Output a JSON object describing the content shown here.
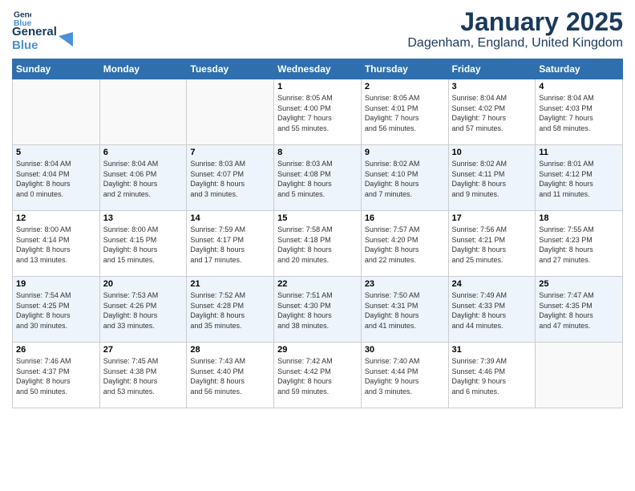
{
  "logo": {
    "line1": "General",
    "line2": "Blue"
  },
  "title": "January 2025",
  "location": "Dagenham, England, United Kingdom",
  "days_of_week": [
    "Sunday",
    "Monday",
    "Tuesday",
    "Wednesday",
    "Thursday",
    "Friday",
    "Saturday"
  ],
  "weeks": [
    {
      "days": [
        {
          "num": "",
          "info": ""
        },
        {
          "num": "",
          "info": ""
        },
        {
          "num": "",
          "info": ""
        },
        {
          "num": "1",
          "info": "Sunrise: 8:05 AM\nSunset: 4:00 PM\nDaylight: 7 hours\nand 55 minutes."
        },
        {
          "num": "2",
          "info": "Sunrise: 8:05 AM\nSunset: 4:01 PM\nDaylight: 7 hours\nand 56 minutes."
        },
        {
          "num": "3",
          "info": "Sunrise: 8:04 AM\nSunset: 4:02 PM\nDaylight: 7 hours\nand 57 minutes."
        },
        {
          "num": "4",
          "info": "Sunrise: 8:04 AM\nSunset: 4:03 PM\nDaylight: 7 hours\nand 58 minutes."
        }
      ]
    },
    {
      "days": [
        {
          "num": "5",
          "info": "Sunrise: 8:04 AM\nSunset: 4:04 PM\nDaylight: 8 hours\nand 0 minutes."
        },
        {
          "num": "6",
          "info": "Sunrise: 8:04 AM\nSunset: 4:06 PM\nDaylight: 8 hours\nand 2 minutes."
        },
        {
          "num": "7",
          "info": "Sunrise: 8:03 AM\nSunset: 4:07 PM\nDaylight: 8 hours\nand 3 minutes."
        },
        {
          "num": "8",
          "info": "Sunrise: 8:03 AM\nSunset: 4:08 PM\nDaylight: 8 hours\nand 5 minutes."
        },
        {
          "num": "9",
          "info": "Sunrise: 8:02 AM\nSunset: 4:10 PM\nDaylight: 8 hours\nand 7 minutes."
        },
        {
          "num": "10",
          "info": "Sunrise: 8:02 AM\nSunset: 4:11 PM\nDaylight: 8 hours\nand 9 minutes."
        },
        {
          "num": "11",
          "info": "Sunrise: 8:01 AM\nSunset: 4:12 PM\nDaylight: 8 hours\nand 11 minutes."
        }
      ]
    },
    {
      "days": [
        {
          "num": "12",
          "info": "Sunrise: 8:00 AM\nSunset: 4:14 PM\nDaylight: 8 hours\nand 13 minutes."
        },
        {
          "num": "13",
          "info": "Sunrise: 8:00 AM\nSunset: 4:15 PM\nDaylight: 8 hours\nand 15 minutes."
        },
        {
          "num": "14",
          "info": "Sunrise: 7:59 AM\nSunset: 4:17 PM\nDaylight: 8 hours\nand 17 minutes."
        },
        {
          "num": "15",
          "info": "Sunrise: 7:58 AM\nSunset: 4:18 PM\nDaylight: 8 hours\nand 20 minutes."
        },
        {
          "num": "16",
          "info": "Sunrise: 7:57 AM\nSunset: 4:20 PM\nDaylight: 8 hours\nand 22 minutes."
        },
        {
          "num": "17",
          "info": "Sunrise: 7:56 AM\nSunset: 4:21 PM\nDaylight: 8 hours\nand 25 minutes."
        },
        {
          "num": "18",
          "info": "Sunrise: 7:55 AM\nSunset: 4:23 PM\nDaylight: 8 hours\nand 27 minutes."
        }
      ]
    },
    {
      "days": [
        {
          "num": "19",
          "info": "Sunrise: 7:54 AM\nSunset: 4:25 PM\nDaylight: 8 hours\nand 30 minutes."
        },
        {
          "num": "20",
          "info": "Sunrise: 7:53 AM\nSunset: 4:26 PM\nDaylight: 8 hours\nand 33 minutes."
        },
        {
          "num": "21",
          "info": "Sunrise: 7:52 AM\nSunset: 4:28 PM\nDaylight: 8 hours\nand 35 minutes."
        },
        {
          "num": "22",
          "info": "Sunrise: 7:51 AM\nSunset: 4:30 PM\nDaylight: 8 hours\nand 38 minutes."
        },
        {
          "num": "23",
          "info": "Sunrise: 7:50 AM\nSunset: 4:31 PM\nDaylight: 8 hours\nand 41 minutes."
        },
        {
          "num": "24",
          "info": "Sunrise: 7:49 AM\nSunset: 4:33 PM\nDaylight: 8 hours\nand 44 minutes."
        },
        {
          "num": "25",
          "info": "Sunrise: 7:47 AM\nSunset: 4:35 PM\nDaylight: 8 hours\nand 47 minutes."
        }
      ]
    },
    {
      "days": [
        {
          "num": "26",
          "info": "Sunrise: 7:46 AM\nSunset: 4:37 PM\nDaylight: 8 hours\nand 50 minutes."
        },
        {
          "num": "27",
          "info": "Sunrise: 7:45 AM\nSunset: 4:38 PM\nDaylight: 8 hours\nand 53 minutes."
        },
        {
          "num": "28",
          "info": "Sunrise: 7:43 AM\nSunset: 4:40 PM\nDaylight: 8 hours\nand 56 minutes."
        },
        {
          "num": "29",
          "info": "Sunrise: 7:42 AM\nSunset: 4:42 PM\nDaylight: 8 hours\nand 59 minutes."
        },
        {
          "num": "30",
          "info": "Sunrise: 7:40 AM\nSunset: 4:44 PM\nDaylight: 9 hours\nand 3 minutes."
        },
        {
          "num": "31",
          "info": "Sunrise: 7:39 AM\nSunset: 4:46 PM\nDaylight: 9 hours\nand 6 minutes."
        },
        {
          "num": "",
          "info": ""
        }
      ]
    }
  ]
}
